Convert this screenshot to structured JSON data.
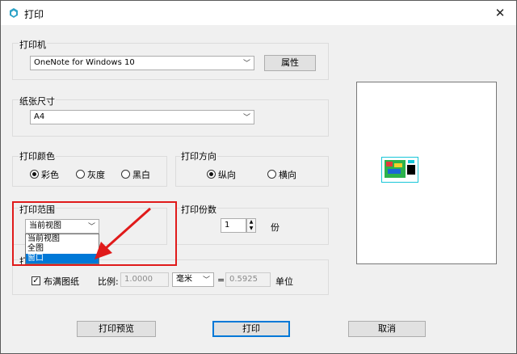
{
  "window": {
    "title": "打印",
    "close_glyph": "✕"
  },
  "printer": {
    "group_label": "打印机",
    "selected": "OneNote for Windows 10",
    "properties_label": "属性"
  },
  "paper": {
    "group_label": "纸张尺寸",
    "selected": "A4"
  },
  "color": {
    "group_label": "打印颜色",
    "options": [
      "彩色",
      "灰度",
      "黑白"
    ],
    "selected": "彩色"
  },
  "orientation": {
    "group_label": "打印方向",
    "options": [
      "纵向",
      "横向"
    ],
    "selected": "纵向"
  },
  "range": {
    "group_label": "打印范围",
    "selected": "当前视图",
    "options": [
      "当前视图",
      "全图",
      "窗口"
    ],
    "highlighted_option": "窗口"
  },
  "copies": {
    "group_label": "打印份数",
    "value": "1",
    "unit": "份"
  },
  "scale": {
    "group_label": "打印比例",
    "group_label_visible": "打印比例",
    "fit_label": "布满图纸",
    "fit_checked": true,
    "ratio_label": "比例:",
    "ratio_value": "1.0000",
    "unit_selected": "毫米",
    "equals": "=",
    "result_value": "0.5925",
    "unit_label": "单位"
  },
  "buttons": {
    "preview": "打印预览",
    "print": "打印",
    "cancel": "取消"
  },
  "colors": {
    "highlight": "#e01a1a",
    "selection": "#0078d7"
  }
}
